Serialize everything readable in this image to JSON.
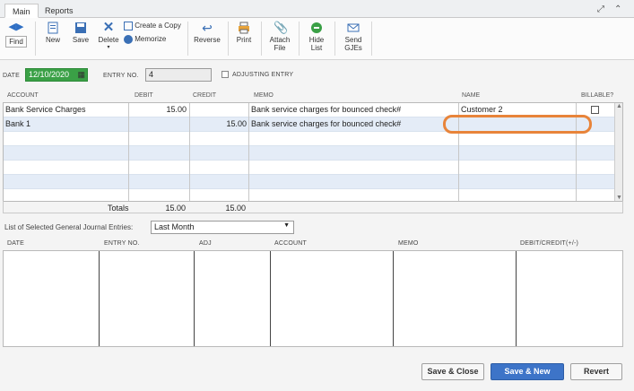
{
  "tabs": [
    {
      "label": "Main"
    },
    {
      "label": "Reports"
    }
  ],
  "toolbar": {
    "find": "Find",
    "new": "New",
    "save": "Save",
    "delete": "Delete",
    "create_copy": "Create a Copy",
    "memorize": "Memorize",
    "reverse": "Reverse",
    "print": "Print",
    "attach": "Attach",
    "attach2": "File",
    "hide": "Hide",
    "hide2": "List",
    "send": "Send",
    "send2": "GJEs"
  },
  "form": {
    "date_label": "DATE",
    "date_value": "12/10/2020",
    "entry_label": "ENTRY NO.",
    "entry_value": "4",
    "adjusting_label": "ADJUSTING ENTRY"
  },
  "grid": {
    "headers": {
      "account": "ACCOUNT",
      "debit": "DEBIT",
      "credit": "CREDIT",
      "memo": "MEMO",
      "name": "NAME",
      "billable": "BILLABLE?"
    },
    "rows": [
      {
        "account": "Bank Service Charges",
        "debit": "15.00",
        "credit": "",
        "memo": "Bank service charges for bounced check#",
        "name": "Customer 2"
      },
      {
        "account": "Bank 1",
        "debit": "",
        "credit": "15.00",
        "memo": "Bank service charges for bounced check#",
        "name": ""
      }
    ],
    "totals_label": "Totals",
    "total_debit": "15.00",
    "total_credit": "15.00"
  },
  "list": {
    "label": "List of Selected General Journal Entries:",
    "filter_value": "Last Month",
    "headers": {
      "date": "DATE",
      "entry": "ENTRY NO.",
      "adj": "ADJ",
      "account": "ACCOUNT",
      "memo": "MEMO",
      "debit_credit": "DEBIT/CREDIT(+/-)"
    }
  },
  "buttons": {
    "save_close": "Save & Close",
    "save_new": "Save & New",
    "revert": "Revert"
  },
  "colors": {
    "highlight": "#e8843a",
    "primary": "#3d74c8"
  }
}
